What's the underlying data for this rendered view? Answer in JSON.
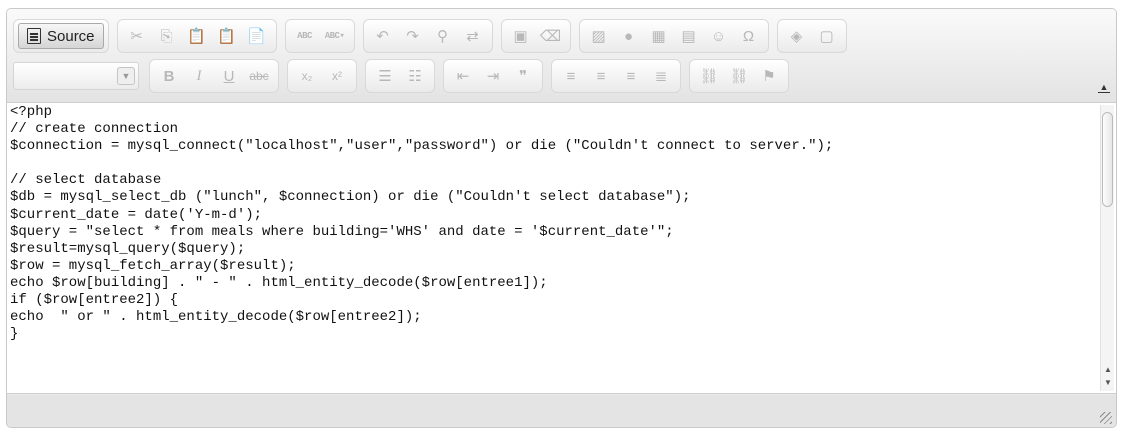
{
  "toolbar": {
    "source_label": "Source",
    "format_value": ""
  },
  "editor": {
    "code_lines": [
      "<?php",
      "// create connection",
      "$connection = mysql_connect(\"localhost\",\"user\",\"password\") or die (\"Couldn't connect to server.\");",
      "",
      "// select database",
      "$db = mysql_select_db (\"lunch\", $connection) or die (\"Couldn't select database\");",
      "$current_date = date('Y-m-d');",
      "$query = \"select * from meals where building='WHS' and date = '$current_date'\";",
      "$result=mysql_query($query);",
      "$row = mysql_fetch_array($result);",
      "echo $row[building] . \" - \" . html_entity_decode($row[entree1]);",
      "if ($row[entree2]) {",
      "echo  \" or \" . html_entity_decode($row[entree2]);",
      "}"
    ]
  },
  "icons": {
    "row1": [
      "cut-icon",
      "copy-icon",
      "paste-icon",
      "paste-text-icon",
      "paste-word-icon",
      "spellcheck-icon",
      "spellcheck-dropdown-icon",
      "undo-icon",
      "redo-icon",
      "find-icon",
      "replace-icon",
      "select-all-icon",
      "remove-format-icon",
      "image-icon",
      "flash-icon",
      "table-icon",
      "horizontal-rule-icon",
      "smiley-icon",
      "special-char-icon",
      "maximize-icon",
      "show-blocks-icon"
    ],
    "row2": [
      "bold-icon",
      "italic-icon",
      "underline-icon",
      "strike-icon",
      "subscript-icon",
      "superscript-icon",
      "numbered-list-icon",
      "bulleted-list-icon",
      "outdent-icon",
      "indent-icon",
      "blockquote-icon",
      "align-left-icon",
      "align-center-icon",
      "align-right-icon",
      "justify-icon",
      "link-icon",
      "unlink-icon",
      "anchor-icon"
    ]
  }
}
